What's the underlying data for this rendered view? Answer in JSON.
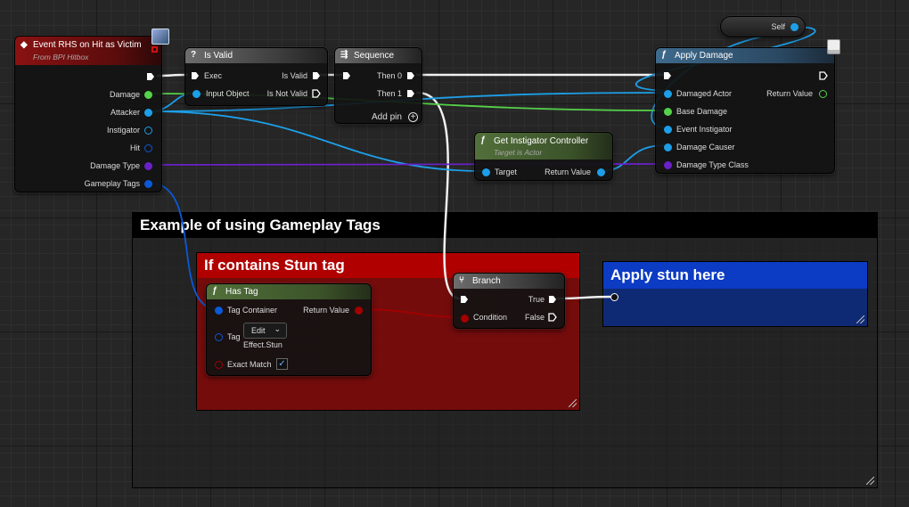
{
  "colors": {
    "exec": "#ffffff",
    "object": "#1d9fe8",
    "float": "#55d14a",
    "class": "#6a21c7",
    "bool": "#a30000",
    "struct": "#0a59d8",
    "event_header": "#8a1212",
    "function_header": "#52703b",
    "macro_header": "#6d6d6d",
    "apply_damage_header": "#3e6a8c",
    "red_comment": "#8a0505",
    "blue_comment": "#0b2a7d"
  },
  "comments": {
    "gameplay_tags": {
      "title": "Example of using Gameplay Tags"
    },
    "stun_tag": {
      "title": "If contains Stun tag"
    },
    "apply_stun": {
      "title": "Apply stun here"
    }
  },
  "self_node": {
    "label": "Self"
  },
  "event_node": {
    "title": "Event RHS on Hit as Victim",
    "subtitle": "From BPI Hitbox",
    "outputs": [
      "Damage",
      "Attacker",
      "Instigator",
      "Hit",
      "Damage Type",
      "Gameplay Tags"
    ]
  },
  "is_valid_node": {
    "title": "Is Valid",
    "glyph": "?",
    "exec_in": "Exec",
    "input_object": "Input Object",
    "is_valid": "Is Valid",
    "is_not_valid": "Is Not Valid"
  },
  "sequence_node": {
    "title": "Sequence",
    "then0": "Then 0",
    "then1": "Then 1",
    "add_pin": "Add pin"
  },
  "apply_damage_node": {
    "title": "Apply Damage",
    "inputs": [
      "Damaged Actor",
      "Base Damage",
      "Event Instigator",
      "Damage Causer",
      "Damage Type Class"
    ],
    "return_value": "Return Value"
  },
  "get_instigator_node": {
    "title": "Get Instigator Controller",
    "subtitle": "Target is Actor",
    "target": "Target",
    "return_value": "Return Value"
  },
  "branch_node": {
    "title": "Branch",
    "condition": "Condition",
    "true": "True",
    "false": "False"
  },
  "has_tag_node": {
    "title": "Has Tag",
    "tag_container": "Tag Container",
    "return_value": "Return Value",
    "tag": "Tag",
    "edit_button": "Edit",
    "tag_value": "Effect.Stun",
    "exact_match": "Exact Match"
  }
}
